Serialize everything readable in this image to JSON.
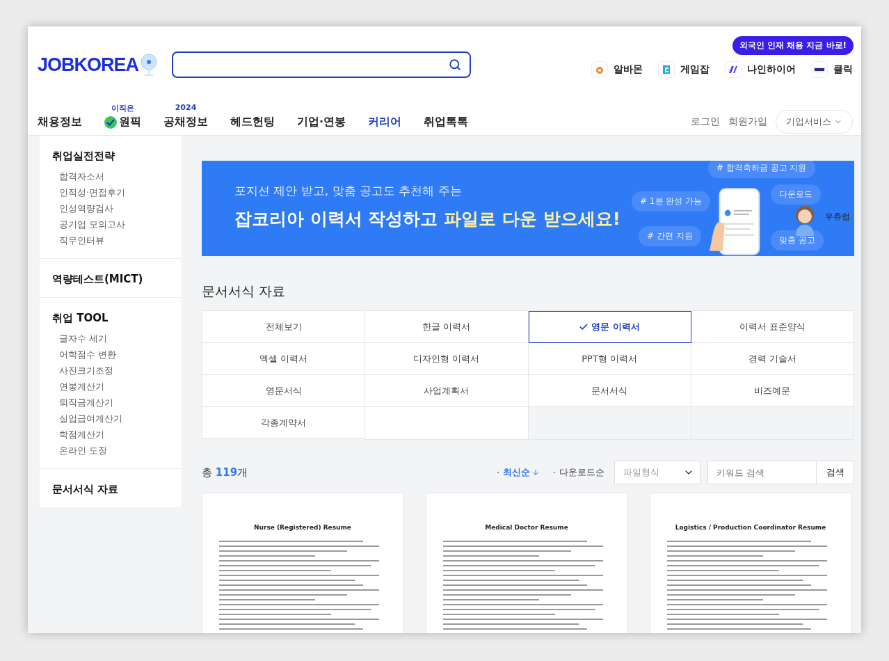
{
  "header": {
    "logo": "JOBKOREA",
    "family_sites": [
      {
        "label": "알바몬",
        "kind": "albamon"
      },
      {
        "label": "게임잡",
        "kind": "gamejob"
      },
      {
        "label": "나인하이어",
        "kind": "ninehire"
      },
      {
        "label": "클릭",
        "kind": "klik"
      }
    ],
    "promo_bubble": "외국인 인재 채용 지금 바로!",
    "nav": [
      {
        "label": "채용정보",
        "selected": false
      },
      {
        "label": "원픽",
        "badge": "이직은",
        "selected": false,
        "kind": "check"
      },
      {
        "label": "공채정보",
        "badge": "2024",
        "selected": false
      },
      {
        "label": "헤드헌팅",
        "selected": false
      },
      {
        "label": "기업·연봉",
        "selected": false
      },
      {
        "label": "커리어",
        "selected": true
      },
      {
        "label": "취업톡톡",
        "selected": false
      }
    ],
    "login": "로그인",
    "signup": "회원가입",
    "business": "기업서비스"
  },
  "sidebar": [
    {
      "title": "취업실전전략",
      "items": [
        "합격자소서",
        "인적성·면접후기",
        "인성역량검사",
        "공기업 모의고사",
        "직무인터뷰"
      ]
    },
    {
      "title": "역량테스트(MICT)"
    },
    {
      "title": "취업 TOOL",
      "items": [
        "글자수 세기",
        "어학점수 변환",
        "사진크기조정",
        "연봉계산기",
        "퇴직금계산기",
        "실업급여계산기",
        "학점계산기",
        "온라인 도장"
      ]
    },
    {
      "title": "문서서식 자료"
    }
  ],
  "banner": {
    "subtitle": "포지션 제안 받고, 맞춤 공고도 추천해 주는",
    "title_plain": "잡코리아 이력서 작성하고",
    "title_highlight": "파일로 다운 받으세요!",
    "tags": [
      "# 합격축하금 공고 지원",
      "# 1분 완성 가능",
      "# 간편 지원",
      "다운로드",
      "맞춤 공고"
    ],
    "mascot_label": "우쥬럽"
  },
  "section_title": "문서서식 자료",
  "categories": [
    {
      "label": "전체보기",
      "selected": false
    },
    {
      "label": "한글 이력서",
      "selected": false
    },
    {
      "label": "영문 이력서",
      "selected": true
    },
    {
      "label": "이력서 표준양식",
      "selected": false
    },
    {
      "label": "엑셀 이력서",
      "selected": false
    },
    {
      "label": "디자인형 이력서",
      "selected": false
    },
    {
      "label": "PPT형 이력서",
      "selected": false
    },
    {
      "label": "경력 기술서",
      "selected": false
    },
    {
      "label": "영문서식",
      "selected": false
    },
    {
      "label": "사업계획서",
      "selected": false
    },
    {
      "label": "문서서식",
      "selected": false
    },
    {
      "label": "비즈예문",
      "selected": false
    },
    {
      "label": "각종계약서",
      "selected": false
    }
  ],
  "results": {
    "prefix": "총",
    "count": "119",
    "suffix": "개",
    "sorts": [
      {
        "label": "최신순",
        "selected": true
      },
      {
        "label": "다운로드순",
        "selected": false
      }
    ],
    "file_type": {
      "placeholder": "파일형식"
    },
    "keyword": {
      "placeholder": "키워드 검색"
    },
    "search_button": "검색"
  },
  "documents": [
    {
      "title": "Nurse (Registered) Resume"
    },
    {
      "title": "Medical Doctor Resume"
    },
    {
      "title": "Logistics / Production Coordinator Resume"
    }
  ]
}
